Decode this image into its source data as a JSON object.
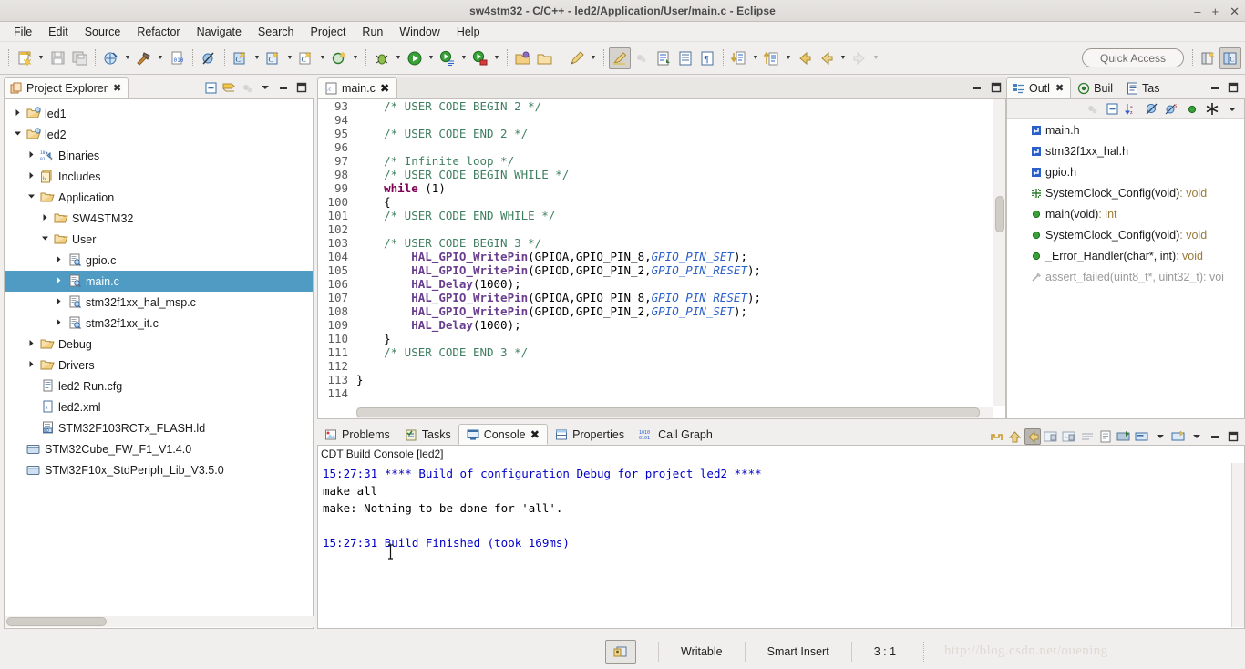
{
  "window": {
    "title": "sw4stm32 - C/C++ - led2/Application/User/main.c - Eclipse",
    "minimize": "–",
    "maximize": "+",
    "close": "✕"
  },
  "menubar": {
    "items": [
      "File",
      "Edit",
      "Source",
      "Refactor",
      "Navigate",
      "Search",
      "Project",
      "Run",
      "Window",
      "Help"
    ]
  },
  "toolbar": {
    "quick_access_placeholder": "Quick Access",
    "buttons": [
      {
        "name": "new-wizard-icon",
        "tip": "New"
      },
      {
        "name": "save-icon",
        "tip": "Save"
      },
      {
        "name": "save-all-icon",
        "tip": "Save All"
      },
      {
        "name": "build-all-icon",
        "tip": "Build All"
      },
      {
        "name": "build-hammer-icon",
        "tip": "Build"
      },
      {
        "name": "binary-file-icon",
        "tip": "Open Element"
      },
      {
        "name": "skip-breakpoints-icon",
        "tip": "Skip All Breakpoints"
      },
      {
        "name": "new-c-cpp-project-icon",
        "tip": "New C/C++ Project"
      },
      {
        "name": "new-c-cpp-source-folder-icon",
        "tip": "New Source Folder"
      },
      {
        "name": "new-c-cpp-file-icon",
        "tip": "New File"
      },
      {
        "name": "new-class-icon",
        "tip": "New Class"
      },
      {
        "name": "debug-icon",
        "tip": "Debug"
      },
      {
        "name": "run-icon",
        "tip": "Run"
      },
      {
        "name": "external-tools-icon",
        "tip": "External Tools"
      },
      {
        "name": "run-last-tool-icon",
        "tip": "Run Last Tool"
      },
      {
        "name": "open-folder-icon",
        "tip": "Open Resource"
      },
      {
        "name": "open-folder-2-icon",
        "tip": "Open Type"
      },
      {
        "name": "pencil-icon",
        "tip": "Annotations"
      },
      {
        "name": "highlight-icon",
        "tip": "Toggle Mark Occurrences"
      },
      {
        "name": "marker-dim-icon",
        "tip": "Markers"
      },
      {
        "name": "next-annotation-icon",
        "tip": "Next Annotation"
      },
      {
        "name": "prev-annotation-icon",
        "tip": "Previous Annotation"
      },
      {
        "name": "show-whitespace-icon",
        "tip": "Show Whitespace Characters"
      },
      {
        "name": "next-edit-icon",
        "tip": "Next Edit Location"
      },
      {
        "name": "prev-edit-icon",
        "tip": "Previous Edit Location"
      },
      {
        "name": "back-icon",
        "tip": "Back"
      },
      {
        "name": "forward-icon",
        "tip": "Forward"
      },
      {
        "name": "open-perspective-icon",
        "tip": "Open Perspective"
      },
      {
        "name": "cpp-perspective-icon",
        "tip": "C/C++ Perspective"
      }
    ]
  },
  "project_explorer": {
    "tab_label": "Project Explorer",
    "tools": [
      "collapse-all-icon",
      "link-with-editor-icon",
      "focus-dim-icon",
      "view-menu-icon",
      "minimize-icon",
      "maximize-icon"
    ],
    "tree": [
      {
        "label": "led1",
        "indent": 0,
        "twisty": "collapsed",
        "icon": "project-folder-icon",
        "selected": false
      },
      {
        "label": "led2",
        "indent": 0,
        "twisty": "expanded",
        "icon": "project-folder-icon",
        "selected": false
      },
      {
        "label": "Binaries",
        "indent": 1,
        "twisty": "collapsed",
        "icon": "binaries-icon",
        "selected": false
      },
      {
        "label": "Includes",
        "indent": 1,
        "twisty": "collapsed",
        "icon": "includes-icon",
        "selected": false
      },
      {
        "label": "Application",
        "indent": 1,
        "twisty": "expanded",
        "icon": "folder-icon",
        "selected": false
      },
      {
        "label": "SW4STM32",
        "indent": 2,
        "twisty": "collapsed",
        "icon": "folder-icon",
        "selected": false
      },
      {
        "label": "User",
        "indent": 2,
        "twisty": "expanded",
        "icon": "folder-icon",
        "selected": false
      },
      {
        "label": "gpio.c",
        "indent": 3,
        "twisty": "collapsed",
        "icon": "c-file-icon",
        "selected": false
      },
      {
        "label": "main.c",
        "indent": 3,
        "twisty": "collapsed",
        "icon": "c-file-icon",
        "selected": true
      },
      {
        "label": "stm32f1xx_hal_msp.c",
        "indent": 3,
        "twisty": "collapsed",
        "icon": "c-file-icon",
        "selected": false
      },
      {
        "label": "stm32f1xx_it.c",
        "indent": 3,
        "twisty": "collapsed",
        "icon": "c-file-icon",
        "selected": false
      },
      {
        "label": "Debug",
        "indent": 1,
        "twisty": "collapsed",
        "icon": "folder-icon",
        "selected": false
      },
      {
        "label": "Drivers",
        "indent": 1,
        "twisty": "collapsed",
        "icon": "folder-icon",
        "selected": false
      },
      {
        "label": "led2 Run.cfg",
        "indent": 1,
        "twisty": "none",
        "icon": "cfg-file-icon",
        "selected": false
      },
      {
        "label": "led2.xml",
        "indent": 1,
        "twisty": "none",
        "icon": "xml-file-icon",
        "selected": false
      },
      {
        "label": "STM32F103RCTx_FLASH.ld",
        "indent": 1,
        "twisty": "none",
        "icon": "ld-file-icon",
        "selected": false
      },
      {
        "label": "STM32Cube_FW_F1_V1.4.0",
        "indent": 0,
        "twisty": "none",
        "icon": "closed-project-icon",
        "selected": false
      },
      {
        "label": "STM32F10x_StdPeriph_Lib_V3.5.0",
        "indent": 0,
        "twisty": "none",
        "icon": "closed-project-icon",
        "selected": false
      }
    ]
  },
  "editor": {
    "tab_label": "main.c",
    "tab_close": "✖",
    "tools": [
      "minimize-icon",
      "maximize-icon"
    ],
    "first_line_number": 93,
    "lines": [
      {
        "n": 93,
        "tokens": [
          {
            "t": "    ",
            "c": "pl"
          },
          {
            "t": "/* USER CODE BEGIN 2 */",
            "c": "cmt"
          }
        ]
      },
      {
        "n": 94,
        "tokens": []
      },
      {
        "n": 95,
        "tokens": [
          {
            "t": "    ",
            "c": "pl"
          },
          {
            "t": "/* USER CODE END 2 */",
            "c": "cmt"
          }
        ]
      },
      {
        "n": 96,
        "tokens": []
      },
      {
        "n": 97,
        "tokens": [
          {
            "t": "    ",
            "c": "pl"
          },
          {
            "t": "/* Infinite loop */",
            "c": "cmt"
          }
        ]
      },
      {
        "n": 98,
        "tokens": [
          {
            "t": "    ",
            "c": "pl"
          },
          {
            "t": "/* USER CODE BEGIN WHILE */",
            "c": "cmt"
          }
        ]
      },
      {
        "n": 99,
        "tokens": [
          {
            "t": "    ",
            "c": "pl"
          },
          {
            "t": "while",
            "c": "kw"
          },
          {
            "t": " (1)",
            "c": "pl"
          }
        ]
      },
      {
        "n": 100,
        "tokens": [
          {
            "t": "    {",
            "c": "pl"
          }
        ]
      },
      {
        "n": 101,
        "tokens": [
          {
            "t": "    ",
            "c": "pl"
          },
          {
            "t": "/* USER CODE END WHILE */",
            "c": "cmt"
          }
        ]
      },
      {
        "n": 102,
        "tokens": []
      },
      {
        "n": 103,
        "tokens": [
          {
            "t": "    ",
            "c": "pl"
          },
          {
            "t": "/* USER CODE BEGIN 3 */",
            "c": "cmt"
          }
        ]
      },
      {
        "n": 104,
        "tokens": [
          {
            "t": "        ",
            "c": "pl"
          },
          {
            "t": "HAL_GPIO_WritePin",
            "c": "fn"
          },
          {
            "t": "(GPIOA,GPIO_PIN_8,",
            "c": "pl"
          },
          {
            "t": "GPIO_PIN_SET",
            "c": "mac"
          },
          {
            "t": ");",
            "c": "pl"
          }
        ]
      },
      {
        "n": 105,
        "tokens": [
          {
            "t": "        ",
            "c": "pl"
          },
          {
            "t": "HAL_GPIO_WritePin",
            "c": "fn"
          },
          {
            "t": "(GPIOD,GPIO_PIN_2,",
            "c": "pl"
          },
          {
            "t": "GPIO_PIN_RESET",
            "c": "mac"
          },
          {
            "t": ");",
            "c": "pl"
          }
        ]
      },
      {
        "n": 106,
        "tokens": [
          {
            "t": "        ",
            "c": "pl"
          },
          {
            "t": "HAL_Delay",
            "c": "fn"
          },
          {
            "t": "(1000);",
            "c": "pl"
          }
        ]
      },
      {
        "n": 107,
        "tokens": [
          {
            "t": "        ",
            "c": "pl"
          },
          {
            "t": "HAL_GPIO_WritePin",
            "c": "fn"
          },
          {
            "t": "(GPIOA,GPIO_PIN_8,",
            "c": "pl"
          },
          {
            "t": "GPIO_PIN_RESET",
            "c": "mac"
          },
          {
            "t": ");",
            "c": "pl"
          }
        ]
      },
      {
        "n": 108,
        "tokens": [
          {
            "t": "        ",
            "c": "pl"
          },
          {
            "t": "HAL_GPIO_WritePin",
            "c": "fn"
          },
          {
            "t": "(GPIOD,GPIO_PIN_2,",
            "c": "pl"
          },
          {
            "t": "GPIO_PIN_SET",
            "c": "mac"
          },
          {
            "t": ");",
            "c": "pl"
          }
        ]
      },
      {
        "n": 109,
        "tokens": [
          {
            "t": "        ",
            "c": "pl"
          },
          {
            "t": "HAL_Delay",
            "c": "fn"
          },
          {
            "t": "(1000);",
            "c": "pl"
          }
        ]
      },
      {
        "n": 110,
        "tokens": [
          {
            "t": "    }",
            "c": "pl"
          }
        ]
      },
      {
        "n": 111,
        "tokens": [
          {
            "t": "    ",
            "c": "pl"
          },
          {
            "t": "/* USER CODE END 3 */",
            "c": "cmt"
          }
        ]
      },
      {
        "n": 112,
        "tokens": []
      },
      {
        "n": 113,
        "tokens": [
          {
            "t": "}",
            "c": "pl"
          }
        ]
      },
      {
        "n": 114,
        "tokens": []
      }
    ]
  },
  "outline": {
    "tabs": [
      {
        "label": "Outl",
        "icon": "outline-icon",
        "active": true,
        "close": "✖"
      },
      {
        "label": "Buil",
        "icon": "build-targets-icon",
        "active": false
      },
      {
        "label": "Tas",
        "icon": "task-list-icon",
        "active": false
      }
    ],
    "tools": [
      "minimize-icon",
      "maximize-icon"
    ],
    "view_tools": [
      "focus-dim-icon",
      "collapse-all-icon",
      "sort-icon",
      "hide-fields-icon",
      "hide-static-icon",
      "hide-nonpublic-icon",
      "hide-macros-icon",
      "view-menu-icon"
    ],
    "items": [
      {
        "label": "main.h",
        "icon": "include-icon",
        "kind": "include",
        "ret": "",
        "dim": false
      },
      {
        "label": "stm32f1xx_hal.h",
        "icon": "include-icon",
        "kind": "include",
        "ret": "",
        "dim": false
      },
      {
        "label": "gpio.h",
        "icon": "include-icon",
        "kind": "include",
        "ret": "",
        "dim": false
      },
      {
        "label": "SystemClock_Config(void)",
        "icon": "prototype-icon",
        "kind": "prototype",
        "ret": " : void",
        "dim": false
      },
      {
        "label": "main(void)",
        "icon": "function-icon",
        "kind": "function",
        "ret": " : int",
        "dim": false
      },
      {
        "label": "SystemClock_Config(void)",
        "icon": "function-icon",
        "kind": "function",
        "ret": " : void",
        "dim": false
      },
      {
        "label": "_Error_Handler(char*, int)",
        "icon": "function-icon",
        "kind": "function",
        "ret": " : void",
        "dim": false
      },
      {
        "label": "assert_failed(uint8_t*, uint32_t)",
        "icon": "inactive-function-icon",
        "kind": "inactive",
        "ret": " : voi",
        "dim": true
      }
    ]
  },
  "console": {
    "tabs": [
      {
        "label": "Problems",
        "icon": "problems-icon",
        "active": false
      },
      {
        "label": "Tasks",
        "icon": "tasks-icon",
        "active": false
      },
      {
        "label": "Console",
        "icon": "console-icon",
        "active": true,
        "close": "✖"
      },
      {
        "label": "Properties",
        "icon": "properties-icon",
        "active": false
      },
      {
        "label": "Call Graph",
        "icon": "call-graph-icon",
        "active": false
      }
    ],
    "tools": [
      "terminate-icon",
      "remove-launch-icon",
      "remove-all-icon",
      "clear-console-icon",
      "scroll-lock-icon",
      "word-wrap-icon",
      "show-console-icon",
      "pin-console-icon",
      "display-selected-console-icon",
      "open-console-icon",
      "minimize-icon",
      "maximize-icon"
    ],
    "header": "CDT Build Console [led2]",
    "lines": [
      {
        "text": "15:27:31 **** Build of configuration Debug for project led2 ****",
        "color": "blue"
      },
      {
        "text": "make all",
        "color": "black"
      },
      {
        "text": "make: Nothing to be done for 'all'.",
        "color": "black"
      },
      {
        "text": "",
        "color": "black"
      },
      {
        "text": "15:27:31 Build Finished (took 169ms)",
        "color": "blue"
      }
    ]
  },
  "statusbar": {
    "writable": "Writable",
    "insert_mode": "Smart Insert",
    "position": "3 : 1",
    "watermark": "http://blog.csdn.net/ouening",
    "lock_icon": "editor-state-icon"
  },
  "colors": {
    "selection": "#4f9bc4",
    "comment": "#3f7f5f",
    "keyword": "#7f0055",
    "function": "#6a3e8e",
    "macro": "#2b60c9",
    "console_blue": "#0000c8",
    "chrome": "#f0efee"
  }
}
